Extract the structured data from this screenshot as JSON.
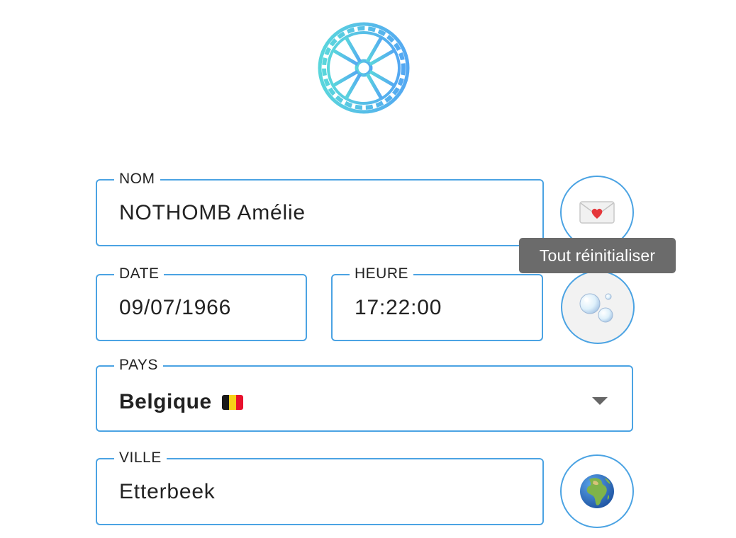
{
  "logo": {
    "icon": "wheel-logo-icon",
    "colors": [
      "#5ad6dc",
      "#54a8f2"
    ]
  },
  "form": {
    "name": {
      "label": "NOM",
      "value": "NOTHOMB Amélie"
    },
    "date": {
      "label": "DATE",
      "value": "09/07/1966"
    },
    "time": {
      "label": "HEURE",
      "value": "17:22:00"
    },
    "country": {
      "label": "PAYS",
      "value": "Belgique",
      "flag": "belgian-flag-icon"
    },
    "city": {
      "label": "VILLE",
      "value": "Etterbeek"
    }
  },
  "buttons": {
    "love_letter": {
      "icon": "love-letter-icon"
    },
    "reset": {
      "icon": "bubbles-icon",
      "tooltip": "Tout réinitialiser"
    },
    "globe": {
      "icon": "globe-africa-icon"
    }
  },
  "colors": {
    "accent": "#4ba3e3",
    "tooltip_bg": "#6b6b6b"
  }
}
